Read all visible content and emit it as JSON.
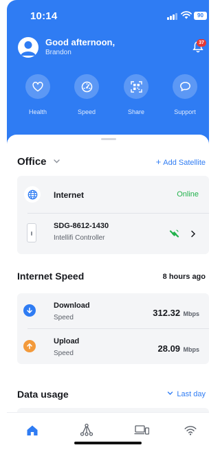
{
  "status_bar": {
    "time": "10:14",
    "battery": "90"
  },
  "header": {
    "greeting": "Good afternoon,",
    "username": "Brandon",
    "notification_count": "37",
    "actions": [
      {
        "label": "Health",
        "icon": "heart-icon"
      },
      {
        "label": "Speed",
        "icon": "speedometer-icon"
      },
      {
        "label": "Share",
        "icon": "qr-code-icon"
      },
      {
        "label": "Support",
        "icon": "chat-bubble-icon"
      }
    ]
  },
  "network": {
    "location": "Office",
    "add_satellite": "Add Satellite",
    "internet": {
      "label": "Internet",
      "status": "Online"
    },
    "device": {
      "id": "SDG-8612-1430",
      "type": "Intellifi Controller"
    }
  },
  "speed": {
    "title": "Internet Speed",
    "updated": "8 hours ago",
    "download": {
      "label": "Download",
      "sub": "Speed",
      "value": "312.32",
      "unit": "Mbps"
    },
    "upload": {
      "label": "Upload",
      "sub": "Speed",
      "value": "28.09",
      "unit": "Mbps"
    }
  },
  "data_usage": {
    "title": "Data usage",
    "range": "Last day"
  },
  "bottom_nav": [
    "home-icon",
    "network-topology-icon",
    "devices-icon",
    "wifi-icon"
  ],
  "colors": {
    "primary": "#2f7cf3",
    "online": "#22b24c",
    "upload": "#f39a3b",
    "badge": "#e53935"
  }
}
